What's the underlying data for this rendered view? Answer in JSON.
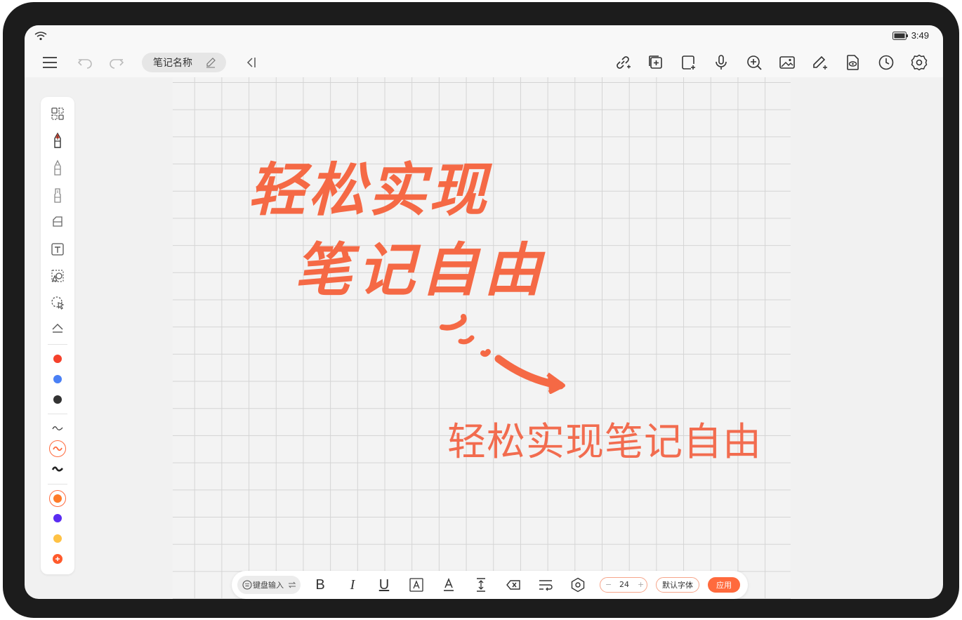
{
  "status_bar": {
    "time": "3:49"
  },
  "toolbar": {
    "note_name": "笔记名称",
    "icons": [
      "menu-icon",
      "undo-icon",
      "redo-icon",
      "collapse-icon",
      "link-icon",
      "add-page-icon",
      "add-note-icon",
      "microphone-icon",
      "zoom-in-icon",
      "image-icon",
      "pen-plus-icon",
      "document-view-icon",
      "history-icon",
      "settings-icon"
    ]
  },
  "canvas": {
    "handwriting_line1": "轻松实现",
    "handwriting_line2": "笔记自由",
    "typed_text": "轻松实现笔记自由"
  },
  "sidebar": {
    "tools": [
      "layout-icon",
      "fountain-pen-icon",
      "pencil-icon",
      "marker-icon",
      "eraser-icon",
      "text-box-icon",
      "shape-icon",
      "lasso-icon",
      "collapse-up-icon"
    ],
    "colors": [
      "#f5412b",
      "#4a80f5",
      "#333333"
    ],
    "stroke_styles": [
      "thin-stroke-icon",
      "medium-stroke-icon",
      "thick-stroke-icon"
    ],
    "custom_colors": [
      "#ff7a28",
      "#5a2cf2",
      "#ffc244",
      "#ff5a2c"
    ],
    "accent": "#ff6a3d"
  },
  "format_bar": {
    "keyboard_input": "键盘输入",
    "bold": "B",
    "italic": "I",
    "underline": "U",
    "font_size": "24",
    "size_minus": "−",
    "size_plus": "+",
    "font_family": "默认字体",
    "apply": "应用"
  }
}
